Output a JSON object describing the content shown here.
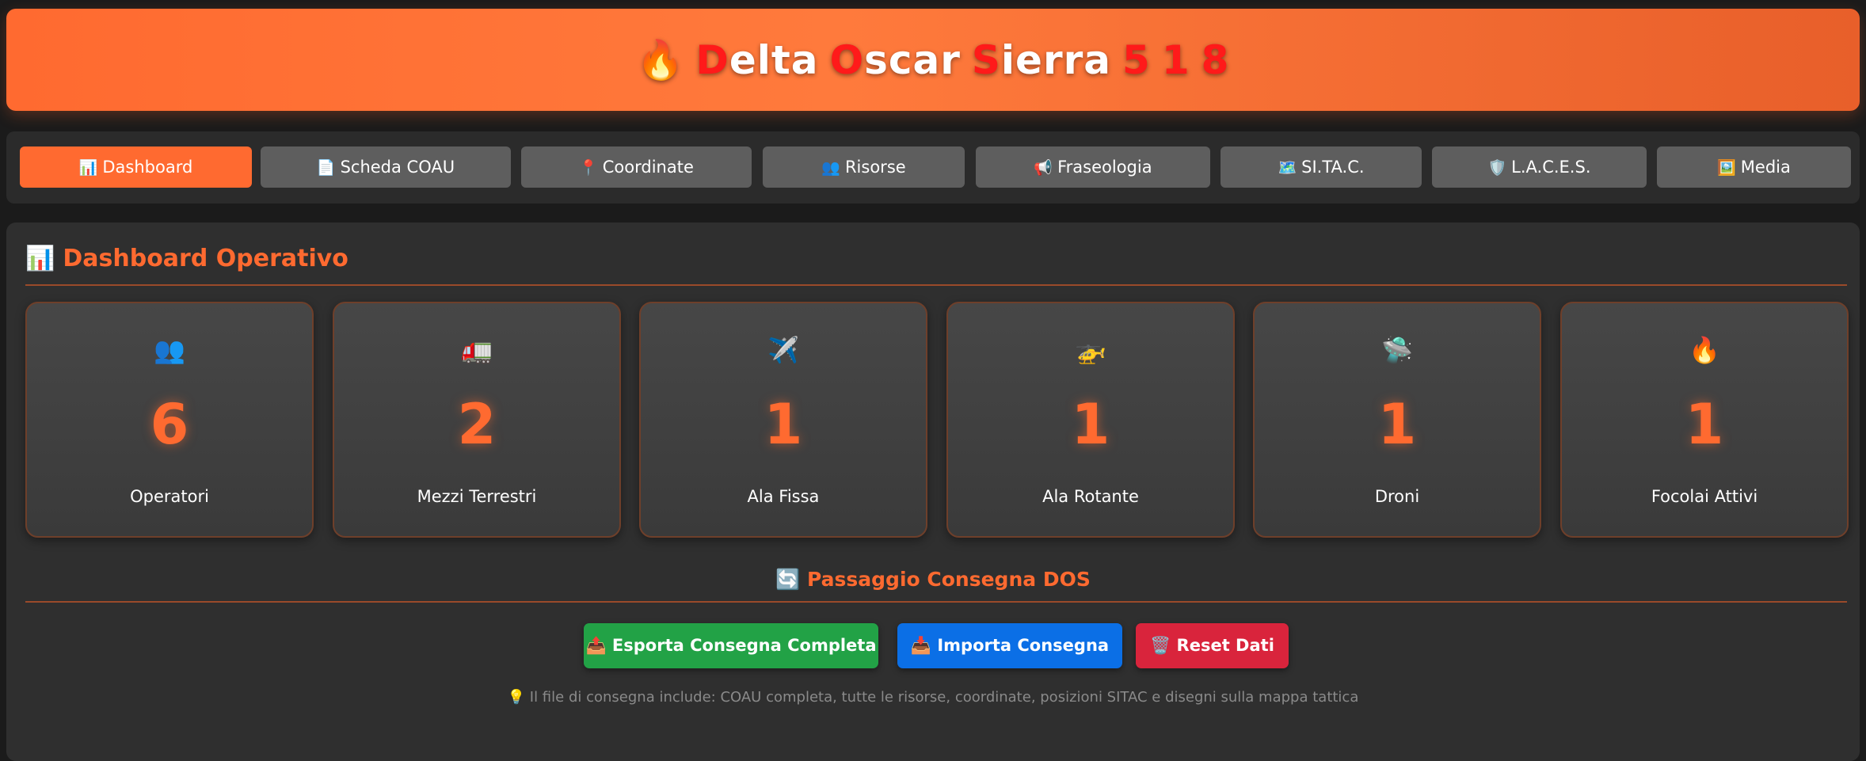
{
  "header": {
    "icon": "fire-icon",
    "flame": "🔥",
    "title": "Delta Oscar Sierra 5 1 8",
    "title_parts": {
      "w1_initial": "D",
      "w1_rest": "elta",
      "w2_initial": "O",
      "w2_rest": "scar",
      "w3_initial": "S",
      "w3_rest": "ierra",
      "num1": "5",
      "num2": "1",
      "num3": "8"
    }
  },
  "nav": {
    "tabs": [
      {
        "icon": "📊",
        "label": "Dashboard",
        "active": true
      },
      {
        "icon": "📄",
        "label": "Scheda COAU"
      },
      {
        "icon": "📍",
        "label": "Coordinate"
      },
      {
        "icon": "👥",
        "label": "Risorse"
      },
      {
        "icon": "📢",
        "label": "Fraseologia"
      },
      {
        "icon": "🗺️",
        "label": "SI.TA.C."
      },
      {
        "icon": "🛡️",
        "label": "L.A.C.E.S."
      },
      {
        "icon": "🖼️",
        "label": "Media"
      }
    ]
  },
  "dashboard": {
    "title_icon": "📊",
    "title": "Dashboard Operativo",
    "cards": [
      {
        "icon": "👥",
        "value": "6",
        "label": "Operatori"
      },
      {
        "icon": "🚛",
        "value": "2",
        "label": "Mezzi Terrestri"
      },
      {
        "icon": "✈️",
        "value": "1",
        "label": "Ala Fissa"
      },
      {
        "icon": "🚁",
        "value": "1",
        "label": "Ala Rotante"
      },
      {
        "icon": "🛸",
        "value": "1",
        "label": "Droni"
      },
      {
        "icon": "🔥",
        "value": "1",
        "label": "Focolai Attivi"
      }
    ]
  },
  "handover": {
    "title": "🔄 Passaggio Consegna DOS",
    "export_label": "📤 Esporta Consegna Completa",
    "import_label": "📥 Importa Consegna",
    "reset_label": "🗑️ Reset Dati",
    "note": "💡 Il file di consegna include: COAU completa, tutte le risorse, coordinate, posizioni SITAC e disegni sulla mappa tattica"
  },
  "colors": {
    "accent": "#ff6a30",
    "title_red": "#ff1a1a",
    "export": "#22a246",
    "import": "#0b6fe6",
    "reset": "#d9243c"
  }
}
